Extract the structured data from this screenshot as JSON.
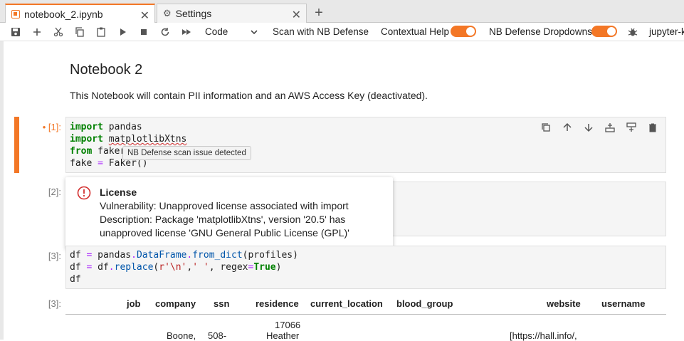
{
  "tabs": [
    {
      "label": "notebook_2.ipynb",
      "icon": "notebook-icon",
      "active": true
    },
    {
      "label": "Settings",
      "icon": "gear-icon",
      "active": false
    }
  ],
  "toolbar": {
    "cell_type": "Code",
    "scan_label": "Scan with NB Defense",
    "contextual_help_label": "Contextual Help",
    "dropdowns_label": "NB Defense Dropdowns",
    "kernel_label": "jupyter-k",
    "accent": "#f37726"
  },
  "notebook": {
    "heading": "Notebook 2",
    "description": "This Notebook will contain PII information and an AWS Access Key (deactivated).",
    "cell1": {
      "prompt": "• [1]:",
      "lines": [
        "import pandas",
        "import matplotlibXtns",
        "from faker",
        "fake = Faker()"
      ]
    },
    "cell2": {
      "prompt": "[2]:"
    },
    "cell3": {
      "prompt": "[3]:",
      "lines": [
        "df = pandas.DataFrame.from_dict(profiles)",
        "df = df.replace(r'\\n',' ', regex=True)",
        "df"
      ]
    },
    "output": {
      "prompt": "[3]:",
      "columns": [
        "job",
        "company",
        "ssn",
        "residence",
        "current_location",
        "blood_group",
        "website",
        "username"
      ],
      "partial_row": {
        "company": "Boone,",
        "ssn": "508-",
        "residence_line1": "17066",
        "residence_line2": "Heather",
        "website": "[https://hall.info/,"
      }
    }
  },
  "tooltip": "NB Defense scan issue detected",
  "popup": {
    "title": "License",
    "vulnerability": "Vulnerability: Unapproved license associated with import",
    "description_1": "Description: Package 'matplotlibXtns', version '20.5' has",
    "description_2": "unapproved license 'GNU General Public License (GPL)'"
  }
}
